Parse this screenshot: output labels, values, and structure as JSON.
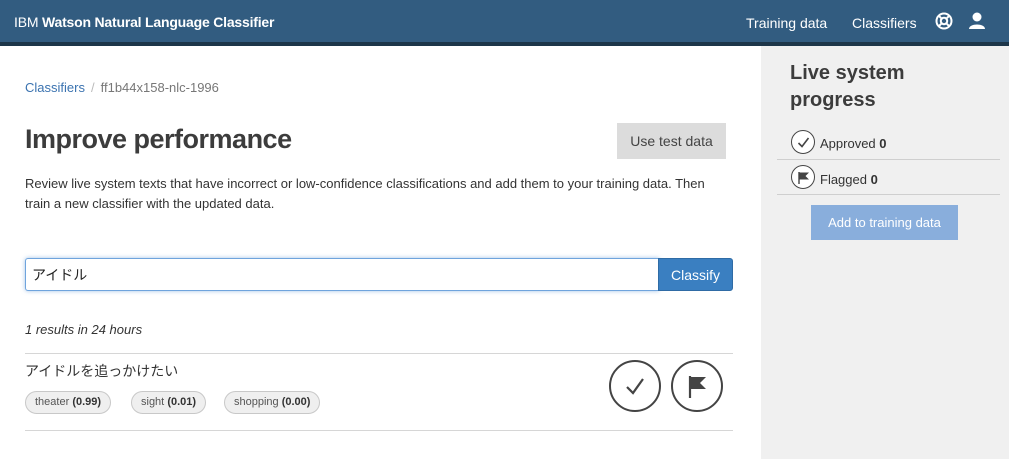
{
  "header": {
    "brand_prefix": "IBM ",
    "brand_name": "Watson Natural Language Classifier",
    "nav": [
      {
        "label": "Training data"
      },
      {
        "label": "Classifiers"
      }
    ],
    "icons": [
      "help-lifebuoy-icon",
      "user-icon"
    ]
  },
  "breadcrumb": {
    "parent": "Classifiers",
    "separator": "/",
    "current": "ff1b44x158-nlc-1996"
  },
  "main": {
    "title": "Improve performance",
    "use_test_data_label": "Use test data",
    "description": "Review live system texts that have incorrect or low-confidence classifications and add them to your training data. Then train a new classifier with the updated data.",
    "search_value": "アイドル",
    "classify_label": "Classify",
    "results_count": "1 results in 24 hours",
    "results": [
      {
        "text": "アイドルを追っかけたい",
        "classes": [
          {
            "name": "theater",
            "score": "(0.99)"
          },
          {
            "name": "sight",
            "score": "(0.01)"
          },
          {
            "name": "shopping",
            "score": "(0.00)"
          }
        ]
      }
    ]
  },
  "sidebar": {
    "title_line1": "Live system",
    "title_line2": "progress",
    "approved_label": "Approved",
    "approved_count": "0",
    "flagged_label": "Flagged",
    "flagged_count": "0",
    "add_button_label": "Add to training data"
  },
  "colors": {
    "header_bg": "#325c80",
    "accent_blue": "#3a7fc1",
    "sidebar_bg": "#f0f0f0",
    "disabled_button": "#89aedc"
  }
}
